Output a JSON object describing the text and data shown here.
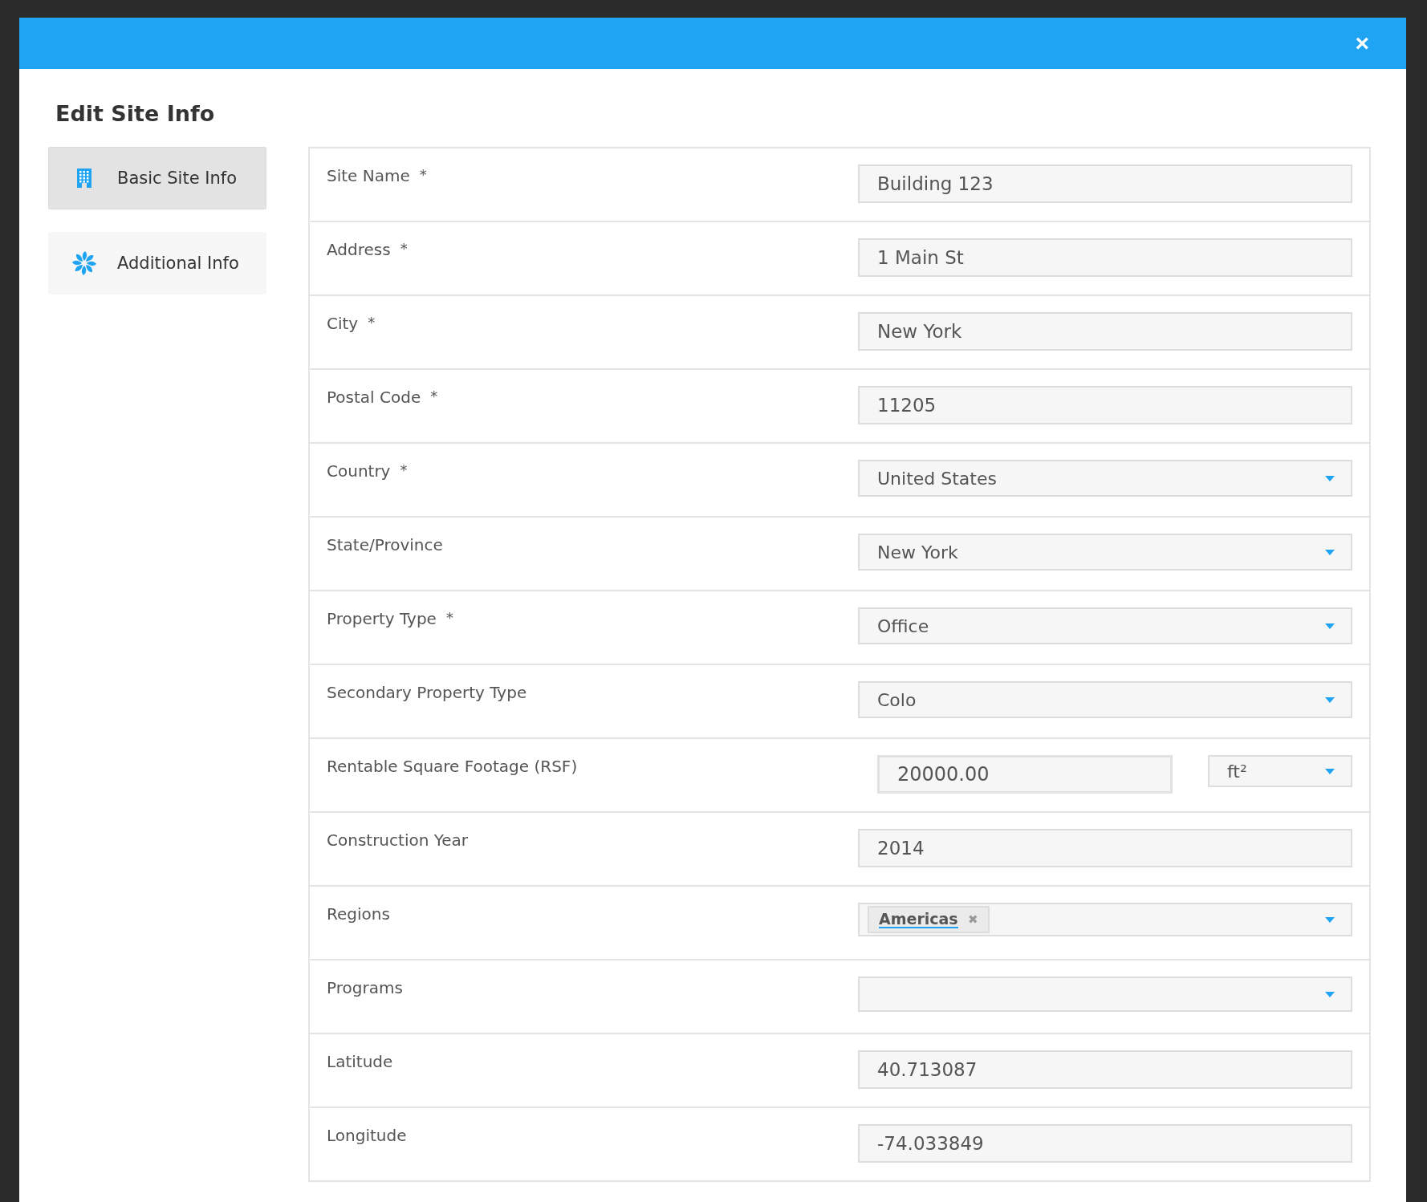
{
  "dialog": {
    "title": "Edit Site Info",
    "close": "×"
  },
  "sidebar": {
    "items": [
      {
        "label": "Basic Site Info",
        "kind": "building",
        "selected": true
      },
      {
        "label": "Additional Info",
        "kind": "fan",
        "selected": false
      }
    ]
  },
  "form": {
    "rows": [
      {
        "kind": "text",
        "label": "Site Name",
        "required_mark": "*",
        "value": "Building 123"
      },
      {
        "kind": "text",
        "label": "Address",
        "required_mark": "*",
        "value": "1 Main St"
      },
      {
        "kind": "text",
        "label": "City",
        "required_mark": "*",
        "value": "New York"
      },
      {
        "kind": "text",
        "label": "Postal Code",
        "required_mark": "*",
        "value": "11205"
      },
      {
        "kind": "select",
        "label": "Country",
        "required_mark": "*",
        "value": "United States"
      },
      {
        "kind": "select",
        "label": "State/Province",
        "value": "New York"
      },
      {
        "kind": "select",
        "label": "Property Type",
        "required_mark": "*",
        "value": "Office"
      },
      {
        "kind": "select",
        "label": "Secondary Property Type",
        "value": "Colo"
      },
      {
        "kind": "unit",
        "label": "Rentable Square Footage (RSF)",
        "value": "20000.00",
        "unit": "ft²"
      },
      {
        "kind": "text",
        "label": "Construction Year",
        "value": "2014"
      },
      {
        "kind": "tags",
        "label": "Regions",
        "tags": [
          {
            "label": "Americas",
            "remove": "✖"
          }
        ]
      },
      {
        "kind": "tags",
        "label": "Programs"
      },
      {
        "kind": "text",
        "label": "Latitude",
        "value": "40.713087"
      },
      {
        "kind": "text",
        "label": "Longitude",
        "value": "-74.033849"
      }
    ]
  }
}
